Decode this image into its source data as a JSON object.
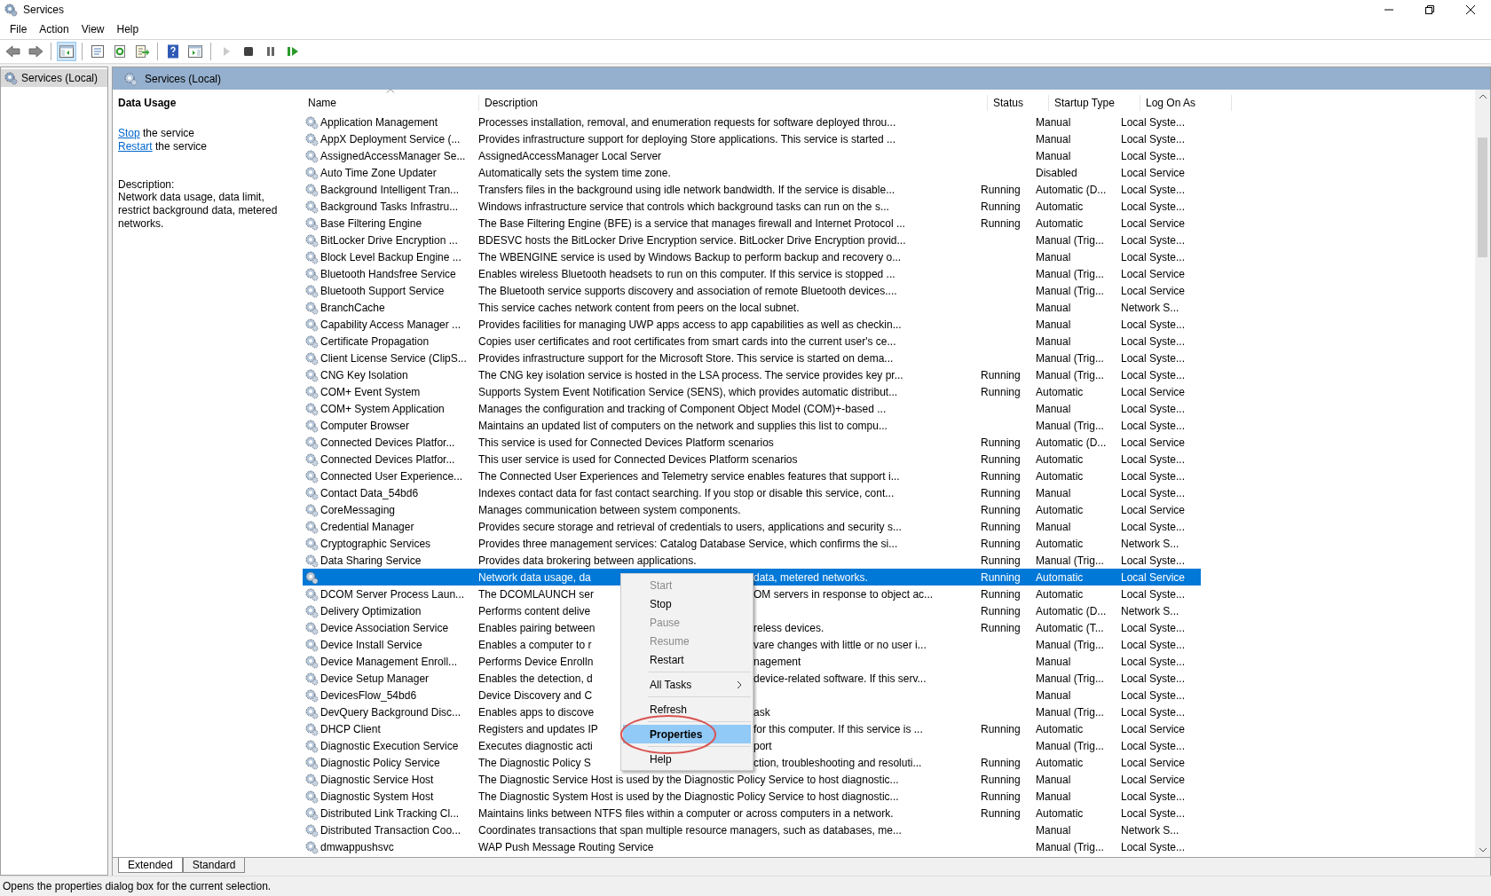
{
  "window": {
    "title": "Services"
  },
  "menu_bar": [
    "File",
    "Action",
    "View",
    "Help"
  ],
  "toolbar": [
    {
      "kind": "back",
      "pressed": false,
      "disabled": false
    },
    {
      "kind": "forward",
      "pressed": false,
      "disabled": false
    },
    {
      "kind": "separator"
    },
    {
      "kind": "tree",
      "pressed": true,
      "disabled": false
    },
    {
      "kind": "separator"
    },
    {
      "kind": "properties",
      "pressed": false,
      "disabled": false
    },
    {
      "kind": "refresh",
      "pressed": false,
      "disabled": false
    },
    {
      "kind": "export",
      "pressed": false,
      "disabled": false
    },
    {
      "kind": "separator"
    },
    {
      "kind": "help",
      "pressed": false,
      "disabled": false
    },
    {
      "kind": "pane",
      "pressed": false,
      "disabled": false
    },
    {
      "kind": "separator"
    },
    {
      "kind": "start",
      "pressed": false,
      "disabled": true
    },
    {
      "kind": "stop",
      "pressed": false,
      "disabled": false
    },
    {
      "kind": "pause",
      "pressed": false,
      "disabled": false
    },
    {
      "kind": "restart",
      "pressed": false,
      "disabled": false
    }
  ],
  "console_tree": {
    "items": [
      {
        "label": "Services (Local)",
        "selected": true
      }
    ]
  },
  "panel_header": {
    "title": "Services (Local)"
  },
  "detail": {
    "title": "Data Usage",
    "actions": [
      {
        "link": "Stop",
        "text": "the service"
      },
      {
        "link": "Restart",
        "text": "the service"
      }
    ],
    "description_label": "Description:",
    "description": "Network data usage, data limit, restrict background data, metered networks."
  },
  "table": {
    "columns": [
      {
        "label": "Name",
        "sorted": true
      },
      {
        "label": "Description",
        "sorted": false
      },
      {
        "label": "Status",
        "sorted": false
      },
      {
        "label": "Startup Type",
        "sorted": false
      },
      {
        "label": "Log On As",
        "sorted": false
      }
    ],
    "rows": [
      {
        "name": "Application Management",
        "description": "Processes installation, removal, and enumeration requests for software deployed throu...",
        "startup_type": "Manual",
        "log_on_as": "Local Syste...",
        "selected": false
      },
      {
        "name": "AppX Deployment Service (...",
        "description": "Provides infrastructure support for deploying Store applications. This service is started ...",
        "startup_type": "Manual",
        "log_on_as": "Local Syste...",
        "selected": false
      },
      {
        "name": "AssignedAccessManager Se...",
        "description": "AssignedAccessManager Local Server",
        "startup_type": "Manual",
        "log_on_as": "Local Syste...",
        "selected": false
      },
      {
        "name": "Auto Time Zone Updater",
        "description": "Automatically sets the system time zone.",
        "startup_type": "Disabled",
        "log_on_as": "Local Service",
        "selected": false
      },
      {
        "name": "Background Intelligent Tran...",
        "description": "Transfers files in the background using idle network bandwidth. If the service is disable...",
        "status": "Running",
        "startup_type": "Automatic (D...",
        "log_on_as": "Local Syste...",
        "selected": false
      },
      {
        "name": "Background Tasks Infrastru...",
        "description": "Windows infrastructure service that controls which background tasks can run on the s...",
        "status": "Running",
        "startup_type": "Automatic",
        "log_on_as": "Local Syste...",
        "selected": false
      },
      {
        "name": "Base Filtering Engine",
        "description": "The Base Filtering Engine (BFE) is a service that manages firewall and Internet Protocol ...",
        "status": "Running",
        "startup_type": "Automatic",
        "log_on_as": "Local Service",
        "selected": false
      },
      {
        "name": "BitLocker Drive Encryption ...",
        "description": "BDESVC hosts the BitLocker Drive Encryption service. BitLocker Drive Encryption provid...",
        "startup_type": "Manual (Trig...",
        "log_on_as": "Local Syste...",
        "selected": false
      },
      {
        "name": "Block Level Backup Engine ...",
        "description": "The WBENGINE service is used by Windows Backup to perform backup and recovery o...",
        "startup_type": "Manual",
        "log_on_as": "Local Syste...",
        "selected": false
      },
      {
        "name": "Bluetooth Handsfree Service",
        "description": "Enables wireless Bluetooth headsets to run on this computer. If this service is stopped ...",
        "startup_type": "Manual (Trig...",
        "log_on_as": "Local Service",
        "selected": false
      },
      {
        "name": "Bluetooth Support Service",
        "description": "The Bluetooth service supports discovery and association of remote Bluetooth devices....",
        "startup_type": "Manual (Trig...",
        "log_on_as": "Local Service",
        "selected": false
      },
      {
        "name": "BranchCache",
        "description": "This service caches network content from peers on the local subnet.",
        "startup_type": "Manual",
        "log_on_as": "Network S...",
        "selected": false
      },
      {
        "name": "Capability Access Manager ...",
        "description": "Provides facilities for managing UWP apps access to app capabilities as well as checkin...",
        "startup_type": "Manual",
        "log_on_as": "Local Syste...",
        "selected": false
      },
      {
        "name": "Certificate Propagation",
        "description": "Copies user certificates and root certificates from smart cards into the current user's ce...",
        "startup_type": "Manual",
        "log_on_as": "Local Syste...",
        "selected": false
      },
      {
        "name": "Client License Service (ClipS...",
        "description": "Provides infrastructure support for the Microsoft Store. This service is started on dema...",
        "startup_type": "Manual (Trig...",
        "log_on_as": "Local Syste...",
        "selected": false
      },
      {
        "name": "CNG Key Isolation",
        "description": "The CNG key isolation service is hosted in the LSA process. The service provides key pr...",
        "status": "Running",
        "startup_type": "Manual (Trig...",
        "log_on_as": "Local Syste...",
        "selected": false
      },
      {
        "name": "COM+ Event System",
        "description": "Supports System Event Notification Service (SENS), which provides automatic distribut...",
        "status": "Running",
        "startup_type": "Automatic",
        "log_on_as": "Local Service",
        "selected": false
      },
      {
        "name": "COM+ System Application",
        "description": "Manages the configuration and tracking of Component Object Model (COM)+-based ...",
        "startup_type": "Manual",
        "log_on_as": "Local Syste...",
        "selected": false
      },
      {
        "name": "Computer Browser",
        "description": "Maintains an updated list of computers on the network and supplies this list to compu...",
        "startup_type": "Manual (Trig...",
        "log_on_as": "Local Syste...",
        "selected": false
      },
      {
        "name": "Connected Devices Platfor...",
        "description": "This service is used for Connected Devices Platform scenarios",
        "status": "Running",
        "startup_type": "Automatic (D...",
        "log_on_as": "Local Service",
        "selected": false
      },
      {
        "name": "Connected Devices Platfor...",
        "description": "This user service is used for Connected Devices Platform scenarios",
        "status": "Running",
        "startup_type": "Automatic",
        "log_on_as": "Local Syste...",
        "selected": false
      },
      {
        "name": "Connected User Experience...",
        "description": "The Connected User Experiences and Telemetry service enables features that support i...",
        "status": "Running",
        "startup_type": "Automatic",
        "log_on_as": "Local Syste...",
        "selected": false
      },
      {
        "name": "Contact Data_54bd6",
        "description": "Indexes contact data for fast contact searching. If you stop or disable this service, cont...",
        "status": "Running",
        "startup_type": "Manual",
        "log_on_as": "Local Syste...",
        "selected": false
      },
      {
        "name": "CoreMessaging",
        "description": "Manages communication between system components.",
        "status": "Running",
        "startup_type": "Automatic",
        "log_on_as": "Local Service",
        "selected": false
      },
      {
        "name": "Credential Manager",
        "description": "Provides secure storage and retrieval of credentials to users, applications and security s...",
        "status": "Running",
        "startup_type": "Manual",
        "log_on_as": "Local Syste...",
        "selected": false
      },
      {
        "name": "Cryptographic Services",
        "description": "Provides three management services: Catalog Database Service, which confirms the si...",
        "status": "Running",
        "startup_type": "Automatic",
        "log_on_as": "Network S...",
        "selected": false
      },
      {
        "name": "Data Sharing Service",
        "description": "Provides data brokering between applications.",
        "status": "Running",
        "startup_type": "Manual (Trig...",
        "log_on_as": "Local Syste...",
        "selected": false
      },
      {
        "description": "Network data usage, da",
        "description_right": "data, metered networks.",
        "status": "Running",
        "startup_type": "Automatic",
        "log_on_as": "Local Service",
        "selected": true
      },
      {
        "name": "DCOM Server Process Laun...",
        "description": "The DCOMLAUNCH ser",
        "description_right": "OM servers in response to object ac...",
        "status": "Running",
        "startup_type": "Automatic",
        "log_on_as": "Local Syste...",
        "selected": false
      },
      {
        "name": "Delivery Optimization",
        "description": "Performs content delive",
        "status": "Running",
        "startup_type": "Automatic (D...",
        "log_on_as": "Network S...",
        "selected": false
      },
      {
        "name": "Device Association Service",
        "description": "Enables pairing between",
        "description_right": "reless devices.",
        "status": "Running",
        "startup_type": "Automatic (T...",
        "log_on_as": "Local Syste...",
        "selected": false
      },
      {
        "name": "Device Install Service",
        "description": "Enables a computer to r",
        "description_right": "vare changes with little or no user i...",
        "startup_type": "Manual (Trig...",
        "log_on_as": "Local Syste...",
        "selected": false
      },
      {
        "name": "Device Management Enroll...",
        "description": "Performs Device Enrolln",
        "description_right": "nagement",
        "startup_type": "Manual",
        "log_on_as": "Local Syste...",
        "selected": false
      },
      {
        "name": "Device Setup Manager",
        "description": "Enables the detection, d",
        "description_right": "device-related software. If this serv...",
        "startup_type": "Manual (Trig...",
        "log_on_as": "Local Syste...",
        "selected": false
      },
      {
        "name": "DevicesFlow_54bd6",
        "description": "Device Discovery and C",
        "startup_type": "Manual",
        "log_on_as": "Local Syste...",
        "selected": false
      },
      {
        "name": "DevQuery Background Disc...",
        "description": "Enables apps to discove",
        "description_right": "ask",
        "startup_type": "Manual (Trig...",
        "log_on_as": "Local Syste...",
        "selected": false
      },
      {
        "name": "DHCP Client",
        "description": "Registers and updates IP",
        "description_right": "for this computer. If this service is ...",
        "status": "Running",
        "startup_type": "Automatic",
        "log_on_as": "Local Service",
        "selected": false
      },
      {
        "name": "Diagnostic Execution Service",
        "description": "Executes diagnostic acti",
        "description_right": "port",
        "startup_type": "Manual (Trig...",
        "log_on_as": "Local Syste...",
        "selected": false
      },
      {
        "name": "Diagnostic Policy Service",
        "description": "The Diagnostic Policy S",
        "description_right": "ction, troubleshooting and resoluti...",
        "status": "Running",
        "startup_type": "Automatic",
        "log_on_as": "Local Service",
        "selected": false
      },
      {
        "name": "Diagnostic Service Host",
        "description": "The Diagnostic Service Host is used by the Diagnostic Policy Service to host diagnostic...",
        "status": "Running",
        "startup_type": "Manual",
        "log_on_as": "Local Service",
        "selected": false
      },
      {
        "name": "Diagnostic System Host",
        "description": "The Diagnostic System Host is used by the Diagnostic Policy Service to host diagnostic...",
        "status": "Running",
        "startup_type": "Manual",
        "log_on_as": "Local Syste...",
        "selected": false
      },
      {
        "name": "Distributed Link Tracking Cl...",
        "description": "Maintains links between NTFS files within a computer or across computers in a network.",
        "status": "Running",
        "startup_type": "Automatic",
        "log_on_as": "Local Syste...",
        "selected": false
      },
      {
        "name": "Distributed Transaction Coo...",
        "description": "Coordinates transactions that span multiple resource managers, such as databases, me...",
        "startup_type": "Manual",
        "log_on_as": "Network S...",
        "selected": false
      },
      {
        "name": "dmwappushsvc",
        "description": "WAP Push Message Routing Service",
        "startup_type": "Manual (Trig...",
        "log_on_as": "Local Syste...",
        "selected": false
      }
    ]
  },
  "context_menu": {
    "items": [
      {
        "kind": "item",
        "label": "Start",
        "disabled": true,
        "selected": false
      },
      {
        "kind": "item",
        "label": "Stop",
        "disabled": false,
        "selected": false
      },
      {
        "kind": "item",
        "label": "Pause",
        "disabled": true,
        "selected": false
      },
      {
        "kind": "item",
        "label": "Resume",
        "disabled": true,
        "selected": false
      },
      {
        "kind": "item",
        "label": "Restart",
        "disabled": false,
        "selected": false
      },
      {
        "kind": "separator"
      },
      {
        "kind": "submenu",
        "label": "All Tasks",
        "disabled": false,
        "selected": false
      },
      {
        "kind": "separator"
      },
      {
        "kind": "item",
        "label": "Refresh",
        "disabled": false,
        "selected": false
      },
      {
        "kind": "separator"
      },
      {
        "kind": "item",
        "label": "Properties",
        "disabled": false,
        "selected": true
      },
      {
        "kind": "separator"
      },
      {
        "kind": "item",
        "label": "Help",
        "disabled": false,
        "selected": false
      }
    ]
  },
  "view_tabs": [
    {
      "label": "Extended",
      "selected": true
    },
    {
      "label": "Standard",
      "selected": false
    }
  ],
  "status_bar": "Opens the properties dialog box for the current selection."
}
